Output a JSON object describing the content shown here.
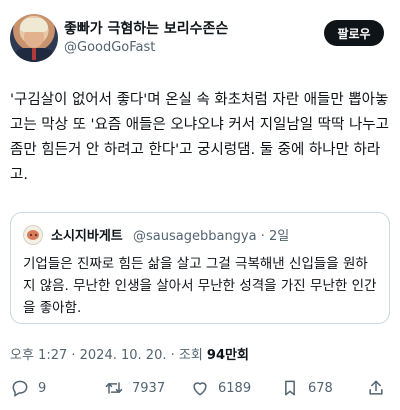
{
  "author": {
    "name": "좋빠가 극혐하는 보리수존슨",
    "handle": "@GoodGoFast",
    "follow_label": "팔로우"
  },
  "tweet": {
    "text": "'구김살이 없어서 좋다'며 온실 속 화초처럼 자란 애들만 뽑아놓고는 막상 또 '요즘 애들은 오냐오냐 커서 지일남일 딱딱 나누고 좀만 힘든거 안 하려고 한다'고 궁시렁댐. 둘 중에 하나만 하라고."
  },
  "quote": {
    "name": "소시지바게트",
    "handle": "@sausagebbangya · 2일",
    "text": "기업들은 진짜로 힘든 삶을 살고 그걸 극복해낸 신입들을 원하지 않음. 무난한 인생을 살아서 무난한 성격을 가진 무난한 인간을 좋아함."
  },
  "meta": {
    "time": "오후 1:27 · 2024. 10. 20. · 조회 ",
    "views": "94만회"
  },
  "actions": {
    "replies": "9",
    "retweets": "7937",
    "likes": "6189",
    "bookmarks": "678"
  },
  "icons": [
    "reply-icon",
    "retweet-icon",
    "like-icon",
    "bookmark-icon",
    "share-icon"
  ]
}
